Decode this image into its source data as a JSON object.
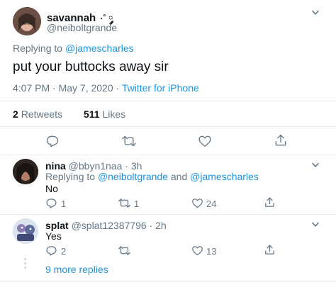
{
  "main_tweet": {
    "display_name": "savannah",
    "name_emoji": "·˚ ༘",
    "handle": "@neiboltgrande",
    "replying_prefix": "Replying to",
    "replying_to": "@jamescharles",
    "text": "put your buttocks away sir",
    "timestamp": "4:07 PM · May 7, 2020 · ",
    "source": "Twitter for iPhone",
    "retweets_count": "2",
    "retweets_label": "Retweets",
    "likes_count": "511",
    "likes_label": "Likes"
  },
  "replies": [
    {
      "display_name": "nina",
      "handle": "@bbyn1naa",
      "time": "· 3h",
      "replying_prefix": "Replying to",
      "replying_to_1": "@neiboltgrande",
      "replying_and": " and ",
      "replying_to_2": "@jamescharles",
      "text": "No",
      "reply_count": "1",
      "retweet_count": "1",
      "like_count": "24"
    },
    {
      "display_name": "splat",
      "handle": "@splat12387796",
      "time": "· 2h",
      "text": "Yes",
      "reply_count": "2",
      "retweet_count": "",
      "like_count": "13"
    }
  ],
  "more_replies": "9 more replies",
  "icons": {
    "reply": "reply-icon",
    "retweet": "retweet-icon",
    "like": "heart-icon",
    "share": "share-icon",
    "more": "chevron-down-icon"
  },
  "colors": {
    "link": "#1b95e0",
    "muted": "#657786",
    "divider": "#e6ecf0",
    "text": "#0f1419"
  }
}
